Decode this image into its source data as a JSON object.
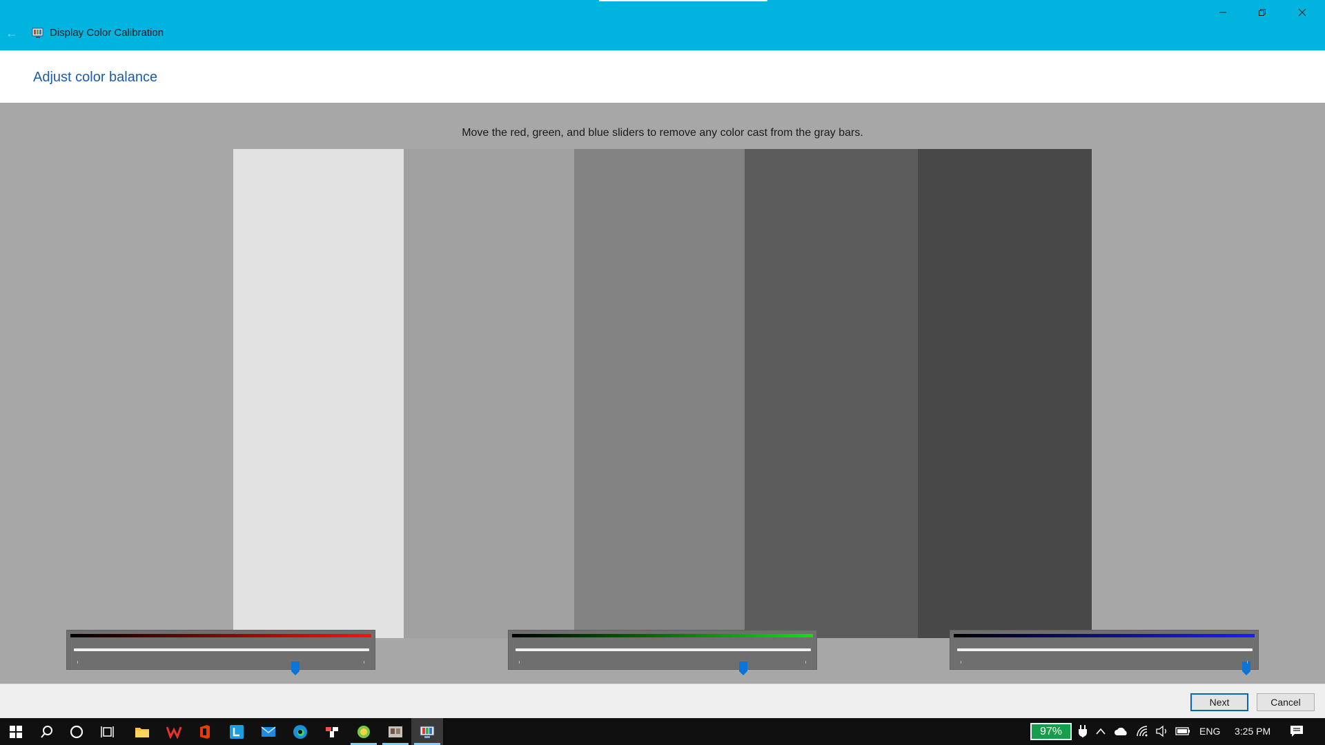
{
  "window": {
    "title": "Display Color Calibration",
    "back_glyph": "←",
    "icons": {
      "back": "back-arrow-icon",
      "app": "display-calibration-icon",
      "minimize": "minimize-icon",
      "maximize": "restore-icon",
      "close": "close-icon"
    }
  },
  "page": {
    "title": "Adjust color balance",
    "instruction": "Move the red, green, and blue sliders to remove any color cast from the gray bars."
  },
  "gray_bars": [
    {
      "color": "#e2e2e2"
    },
    {
      "color": "#a1a1a1"
    },
    {
      "color": "#838383"
    },
    {
      "color": "#5c5c5c"
    },
    {
      "color": "#484848"
    }
  ],
  "sliders": [
    {
      "name": "red",
      "gradient_end": "#ff1010",
      "value": 0.75
    },
    {
      "name": "green",
      "gradient_end": "#12e012",
      "value": 0.77
    },
    {
      "name": "blue",
      "gradient_end": "#1c1cff",
      "value": 0.98
    }
  ],
  "buttons": {
    "next": "Next",
    "cancel": "Cancel"
  },
  "taskbar": {
    "apps": [
      {
        "icon": "windows-start-icon"
      },
      {
        "icon": "search-icon"
      },
      {
        "icon": "cortana-icon"
      },
      {
        "icon": "task-view-icon"
      },
      {
        "icon": "file-explorer-icon"
      },
      {
        "icon": "wps-office-icon"
      },
      {
        "icon": "office-icon"
      },
      {
        "icon": "l-app-icon"
      },
      {
        "icon": "mail-icon"
      },
      {
        "icon": "edge-icon"
      },
      {
        "icon": "app-icon"
      },
      {
        "icon": "green-app-icon",
        "active": true
      },
      {
        "icon": "photos-app-icon",
        "active": true
      },
      {
        "icon": "display-calibration-icon",
        "active": true
      }
    ],
    "battery_percent": "97%",
    "language": "ENG",
    "time": "3:25 PM",
    "tray_icons": [
      "power-plug-icon",
      "chevron-up-icon",
      "onedrive-cloud-icon",
      "wifi-icon",
      "volume-icon",
      "battery-icon",
      "notification-icon"
    ]
  }
}
